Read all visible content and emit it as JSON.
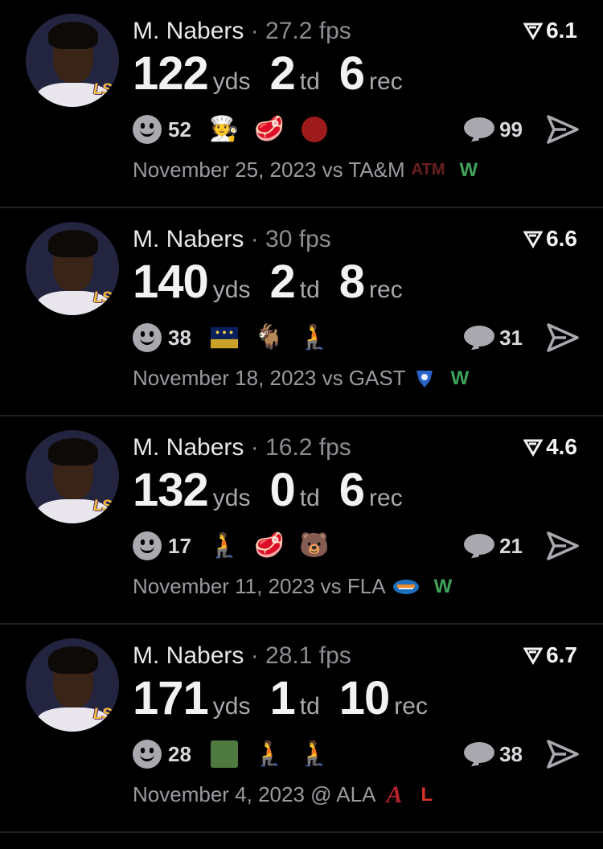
{
  "colors": {
    "win": "#3fa35a",
    "loss": "#d8342c",
    "background": "#000000"
  },
  "cards": [
    {
      "player": "M. Nabers",
      "fps": "27.2 fps",
      "rating": "6.1",
      "yds": "122",
      "td": "2",
      "rec": "6",
      "labels": {
        "yds": "yds",
        "td": "td",
        "rec": "rec"
      },
      "reaction_count": "52",
      "emojis": [
        "🧑‍🍳",
        "🥩",
        "red-circle"
      ],
      "comments": "99",
      "date": "November 25, 2023 vs TA&M",
      "opponent_logo": "ATM",
      "result": "W"
    },
    {
      "player": "M. Nabers",
      "fps": "30 fps",
      "rating": "6.6",
      "yds": "140",
      "td": "2",
      "rec": "8",
      "labels": {
        "yds": "yds",
        "td": "td",
        "rec": "rec"
      },
      "reaction_count": "38",
      "emojis": [
        "flag",
        "🐐",
        "🧎"
      ],
      "comments": "31",
      "date": "November 18, 2023 vs GAST",
      "opponent_logo": "panther-icon",
      "result": "W"
    },
    {
      "player": "M. Nabers",
      "fps": "16.2 fps",
      "rating": "4.6",
      "yds": "132",
      "td": "0",
      "rec": "6",
      "labels": {
        "yds": "yds",
        "td": "td",
        "rec": "rec"
      },
      "reaction_count": "17",
      "emojis": [
        "🧎",
        "🥩",
        "🐻"
      ],
      "comments": "21",
      "date": "November 11, 2023 vs FLA",
      "opponent_logo": "gator-icon",
      "result": "W"
    },
    {
      "player": "M. Nabers",
      "fps": "28.1 fps",
      "rating": "6.7",
      "yds": "171",
      "td": "1",
      "rec": "10",
      "labels": {
        "yds": "yds",
        "td": "td",
        "rec": "rec"
      },
      "reaction_count": "28",
      "emojis": [
        "green-square",
        "🧎",
        "🧎"
      ],
      "comments": "38",
      "date": "November 4, 2023 @ ALA",
      "opponent_logo": "A",
      "result": "L"
    }
  ]
}
